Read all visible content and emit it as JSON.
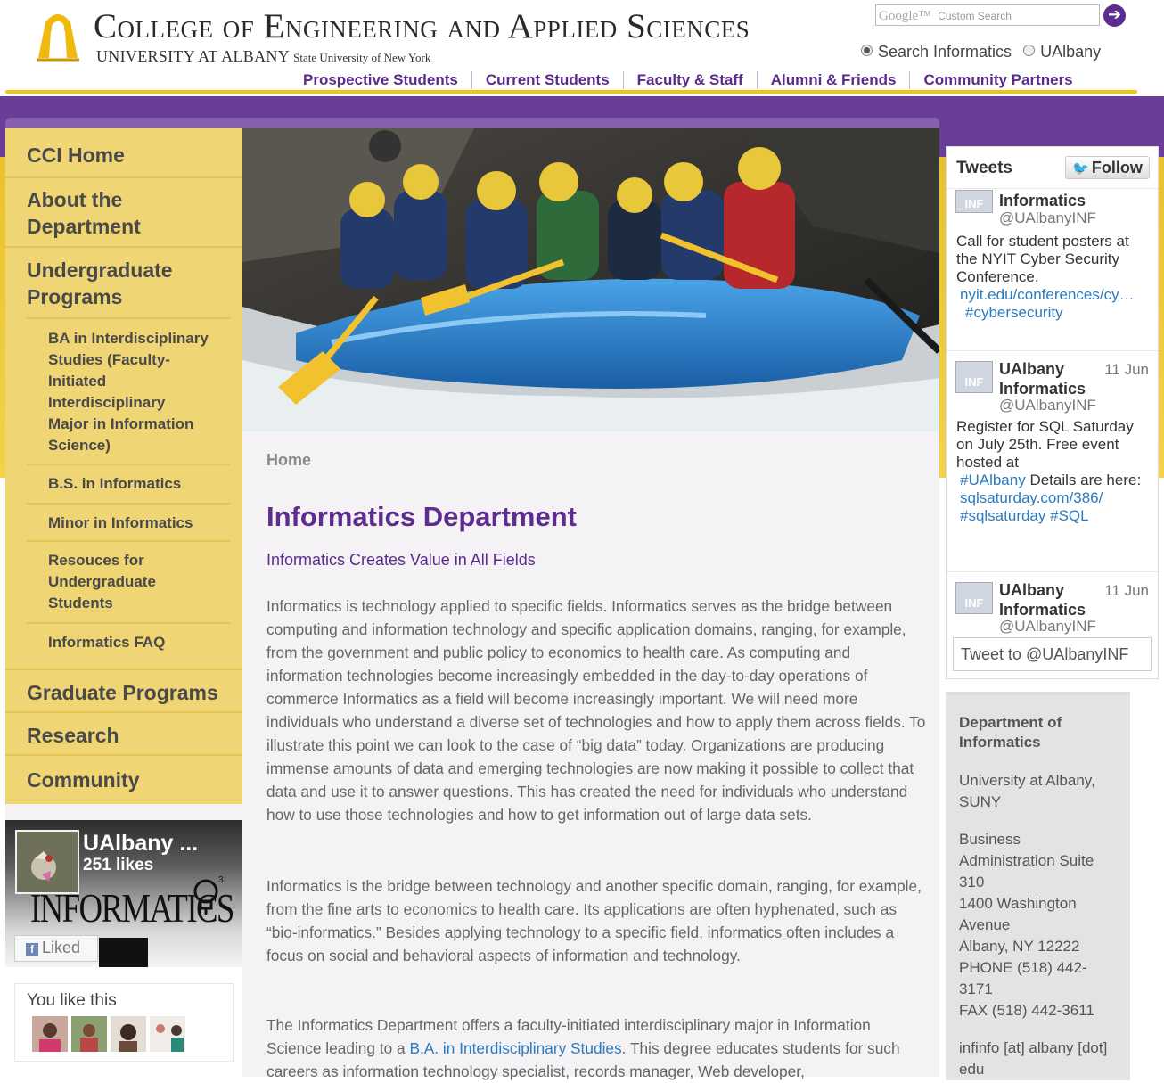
{
  "header": {
    "college_title": "College of Engineering and Applied Sciences",
    "university_name": "UNIVERSITY AT ALBANY",
    "university_suffix": "State University of New York",
    "search": {
      "brand": "Google™",
      "placeholder": "Custom Search",
      "go_icon": "arrow-right-icon"
    },
    "search_scope": {
      "options": [
        "Search Informatics",
        "UAlbany"
      ],
      "selected": "Search Informatics"
    },
    "top_nav": [
      "Prospective Students",
      "Current Students",
      "Faculty & Staff",
      "Alumni & Friends",
      "Community Partners"
    ]
  },
  "left_nav": {
    "items": [
      {
        "label": "CCI Home"
      },
      {
        "label": "About the Department"
      },
      {
        "label": "Undergraduate Programs"
      },
      {
        "label": "BA in Interdisciplinary Studies (Faculty-Initiated Interdisciplinary Major in Information Science)"
      },
      {
        "label": "B.S. in Informatics"
      },
      {
        "label": "Minor in Informatics"
      },
      {
        "label": "Resouces for Undergraduate Students"
      },
      {
        "label": "Informatics FAQ"
      },
      {
        "label": "Graduate Programs"
      },
      {
        "label": "Research"
      },
      {
        "label": "Community"
      }
    ]
  },
  "facebook": {
    "page_name": "UAlbany ...",
    "likes": "251 likes",
    "logo_text": "INFORMATICS",
    "liked_label": "Liked",
    "you_like_this": "You like this"
  },
  "main": {
    "breadcrumb": "Home",
    "title": "Informatics Department",
    "subtitle": "Informatics Creates Value in All Fields",
    "paragraph1": "Informatics is technology applied to specific fields. Informatics serves as the bridge between computing and information technology and specific application domains, ranging, for example, from the government and public policy to economics to health care. As computing and information technologies become increasingly embedded in the day-to-day operations of commerce Informatics as a field will become increasingly important. We will need more individuals who understand a diverse set of technologies and how to apply them across fields. To illustrate this point we can look to the case of “big data” today. Organizations are producing immense amounts of data and emerging technologies are now making it possible to collect that data and use it to answer questions. This has created the need for individuals who understand how to use those technologies and how to get information out of large data sets.",
    "paragraph2": "Informatics is the bridge between technology and another specific domain, ranging, for example, from the fine arts to economics to health care.  Its applications are often hyphenated, such as “bio-informatics.” Besides applying technology to a specific field, informatics often includes a focus on social and behavioral aspects of information and technology.",
    "paragraph3_before": "The Informatics Department offers a faculty-initiated interdisciplinary major in Information Science leading to a ",
    "paragraph3_link": "B.A. in Interdisciplinary Studies",
    "paragraph3_after": ". This degree educates students for such careers as information technology specialist, records manager, Web developer,"
  },
  "tweets": {
    "title": "Tweets",
    "follow_label": "Follow",
    "items": [
      {
        "name": "Informatics",
        "handle": "@UAlbanyINF",
        "date": "",
        "text": "Call for student posters at the NYIT Cyber Security Conference.",
        "link": "nyit.edu/conferences/cy…",
        "hashtags": "#cybersecurity"
      },
      {
        "name_line1": "UAlbany",
        "name_line2": "Informatics",
        "handle": "@UAlbanyINF",
        "date": "11 Jun",
        "text_a": "Register for SQL Saturday on July 25th. Free event hosted at",
        "hashtag_a": "#UAlbany",
        "text_b": "Details are here:",
        "link": "sqlsaturday.com/386/",
        "hashtags": "#sqlsaturday #SQL"
      },
      {
        "name_line1": "UAlbany",
        "name_line2": "Informatics",
        "handle": "@UAlbanyINF",
        "date": "11 Jun"
      }
    ],
    "tweet_to": "Tweet to @UAlbanyINF"
  },
  "contact": {
    "department": "Department of Informatics",
    "university": "University at Albany, SUNY",
    "building": "Business Administration Suite 310",
    "street": "1400 Washington Avenue",
    "city": "Albany, NY 12222",
    "phone": "PHONE (518) 442-3171",
    "fax": "FAX (518) 442-3611",
    "email": "infinfo [at] albany [dot] edu"
  },
  "colors": {
    "purple": "#5c2d8f",
    "gold": "#f1c40f",
    "nav_gold": "#f0d574",
    "link_blue": "#2b7bbf"
  }
}
